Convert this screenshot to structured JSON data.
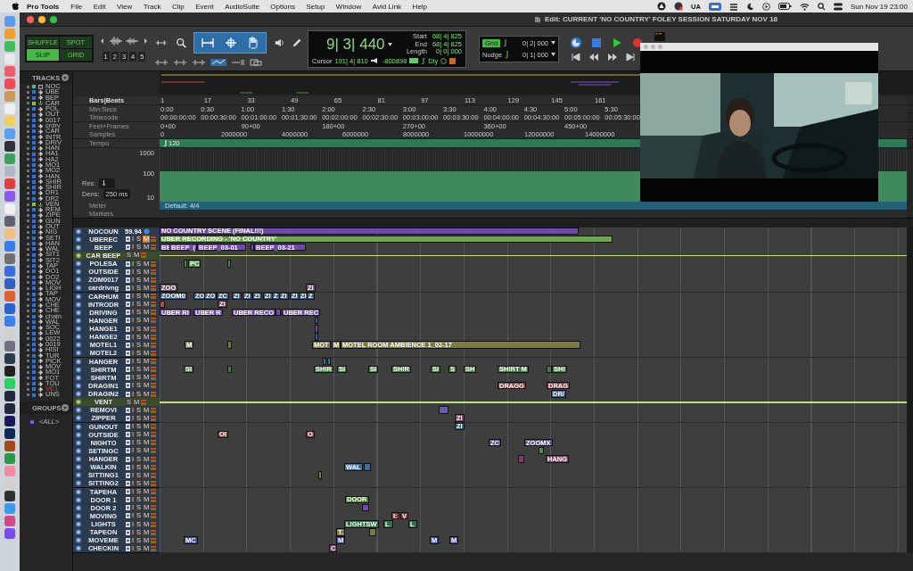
{
  "menu_bar": {
    "app": "Pro Tools",
    "menus": [
      "File",
      "Edit",
      "View",
      "Track",
      "Clip",
      "Event",
      "AudioSuite",
      "Options",
      "Setup",
      "Window",
      "Avid Link",
      "Help"
    ],
    "status_text": "UA",
    "clock": "Sun Nov 19  23:00"
  },
  "window": {
    "title": "Edit: CURRENT 'NO COUNTRY' FOLEY SESSION SATURDAY NOV 18"
  },
  "toolbar": {
    "modes": [
      {
        "label": "SHUFFLE",
        "selected": false
      },
      {
        "label": "SPOT",
        "selected": false
      },
      {
        "label": "SLIP",
        "selected": true
      },
      {
        "label": "GRID",
        "selected": false
      }
    ],
    "zoom_presets": [
      "1",
      "2",
      "3",
      "4",
      "5"
    ],
    "counter": {
      "main": "9| 3| 440",
      "start_label": "Start",
      "start": "68| 4| 825",
      "end_label": "End",
      "end": "68| 4| 825",
      "length_label": "Length",
      "length": "0| 0| 000",
      "cursor_label": "Cursor",
      "cursor": "191| 4| 810",
      "sample": "-800898",
      "delay": "Dly"
    },
    "grid": {
      "label": "Grid",
      "value": "0| 2| 000"
    },
    "nudge": {
      "label": "Nudge",
      "value": "0| 1| 000"
    }
  },
  "tracks_panel": {
    "title": "TRACKS",
    "tracks": [
      {
        "name": "NOC",
        "kind": "video",
        "color": "#3fb39b",
        "selected": false
      },
      {
        "name": "UBE",
        "kind": "audio",
        "color": "#2f6fe0",
        "selected": false
      },
      {
        "name": "BEP",
        "kind": "audio",
        "color": "#2f6fe0",
        "selected": false
      },
      {
        "name": "CAR",
        "kind": "folder",
        "color": "#8fbf3a",
        "selected": false
      },
      {
        "name": "POL",
        "kind": "audio",
        "color": "#2f6fe0",
        "selected": false
      },
      {
        "name": "OUT",
        "kind": "audio",
        "color": "#2f6fe0",
        "selected": false
      },
      {
        "name": "0017",
        "kind": "audio",
        "color": "#2f6fe0",
        "selected": false
      },
      {
        "name": "crdrv",
        "kind": "audio",
        "color": "#2f6fe0",
        "selected": false
      },
      {
        "name": "CAR",
        "kind": "audio",
        "color": "#2f6fe0",
        "selected": false
      },
      {
        "name": "INTR",
        "kind": "audio",
        "color": "#2f6fe0",
        "selected": false
      },
      {
        "name": "DRIV",
        "kind": "audio",
        "color": "#2f6fe0",
        "selected": false
      },
      {
        "name": "HAN",
        "kind": "audio",
        "color": "#2f6fe0",
        "selected": false
      },
      {
        "name": "HA1",
        "kind": "audio",
        "color": "#2f6fe0",
        "selected": false
      },
      {
        "name": "HA2",
        "kind": "audio",
        "color": "#2f6fe0",
        "selected": false
      },
      {
        "name": "MO1",
        "kind": "audio",
        "color": "#2f6fe0",
        "selected": false
      },
      {
        "name": "MO2",
        "kind": "audio",
        "color": "#2f6fe0",
        "selected": false
      },
      {
        "name": "HAN",
        "kind": "audio",
        "color": "#2f6fe0",
        "selected": false
      },
      {
        "name": "SHIR",
        "kind": "audio",
        "color": "#2f6fe0",
        "selected": false
      },
      {
        "name": "SHIR",
        "kind": "audio",
        "color": "#2f6fe0",
        "selected": false
      },
      {
        "name": "DR1",
        "kind": "audio",
        "color": "#2f6fe0",
        "selected": false
      },
      {
        "name": "DR2",
        "kind": "audio",
        "color": "#2f6fe0",
        "selected": false
      },
      {
        "name": "VEN",
        "kind": "folder",
        "color": "#8fbf3a",
        "selected": false
      },
      {
        "name": "REM",
        "kind": "audio",
        "color": "#2f6fe0",
        "selected": false
      },
      {
        "name": "ZIPE",
        "kind": "audio",
        "color": "#2f6fe0",
        "selected": false
      },
      {
        "name": "GUN",
        "kind": "audio",
        "color": "#2f6fe0",
        "selected": false
      },
      {
        "name": "OUT",
        "kind": "audio",
        "color": "#2f6fe0",
        "selected": false
      },
      {
        "name": "NIG",
        "kind": "audio",
        "color": "#2f6fe0",
        "selected": false
      },
      {
        "name": "SETI",
        "kind": "audio",
        "color": "#2f6fe0",
        "selected": false
      },
      {
        "name": "HAN",
        "kind": "audio",
        "color": "#2f6fe0",
        "selected": false
      },
      {
        "name": "WAL",
        "kind": "audio",
        "color": "#2f6fe0",
        "selected": false
      },
      {
        "name": "SIT1",
        "kind": "audio",
        "color": "#2f6fe0",
        "selected": false
      },
      {
        "name": "SIT2",
        "kind": "audio",
        "color": "#2f6fe0",
        "selected": false
      },
      {
        "name": "TAP",
        "kind": "audio",
        "color": "#2f6fe0",
        "selected": false
      },
      {
        "name": "DO1",
        "kind": "audio",
        "color": "#2f6fe0",
        "selected": false
      },
      {
        "name": "DO2",
        "kind": "audio",
        "color": "#2f6fe0",
        "selected": false
      },
      {
        "name": "MOV",
        "kind": "audio",
        "color": "#2f6fe0",
        "selected": false
      },
      {
        "name": "LIGH",
        "kind": "audio",
        "color": "#2f6fe0",
        "selected": false
      },
      {
        "name": "TAP",
        "kind": "audio",
        "color": "#2f6fe0",
        "selected": false
      },
      {
        "name": "MOV",
        "kind": "audio",
        "color": "#2f6fe0",
        "selected": false
      },
      {
        "name": "CHE",
        "kind": "audio",
        "color": "#2f6fe0",
        "selected": false
      },
      {
        "name": "CHE",
        "kind": "audio",
        "color": "#2f6fe0",
        "selected": false
      },
      {
        "name": "chain",
        "kind": "audio",
        "color": "#2f6fe0",
        "selected": false
      },
      {
        "name": "WAL",
        "kind": "audio",
        "color": "#2f6fe0",
        "selected": false
      },
      {
        "name": "SOC",
        "kind": "audio",
        "color": "#2f6fe0",
        "selected": false
      },
      {
        "name": "LEW",
        "kind": "audio",
        "color": "#2f6fe0",
        "selected": false
      },
      {
        "name": "0022",
        "kind": "audio",
        "color": "#2f6fe0",
        "selected": false
      },
      {
        "name": "0019",
        "kind": "audio",
        "color": "#2f6fe0",
        "selected": false
      },
      {
        "name": "HISI",
        "kind": "audio",
        "color": "#2f6fe0",
        "selected": false
      },
      {
        "name": "TUR",
        "kind": "audio",
        "color": "#2f6fe0",
        "selected": false
      },
      {
        "name": "PICK",
        "kind": "audio",
        "color": "#2f6fe0",
        "selected": false
      },
      {
        "name": "MOV",
        "kind": "audio",
        "color": "#2f6fe0",
        "selected": false
      },
      {
        "name": "MO1",
        "kind": "audio",
        "color": "#2f6fe0",
        "selected": false
      },
      {
        "name": "FOT",
        "kind": "audio",
        "color": "#2f6fe0",
        "selected": false
      },
      {
        "name": "TOU",
        "kind": "audio",
        "color": "#2f6fe0",
        "selected": false
      },
      {
        "name": "VE1",
        "kind": "audio",
        "color": "#2f6fe0",
        "selected": true
      },
      {
        "name": "UNS",
        "kind": "audio",
        "color": "#2f6fe0",
        "selected": false
      }
    ]
  },
  "groups_panel": {
    "title": "GROUPS",
    "groups": [
      {
        "name": "<ALL>",
        "color": "#6a5cff"
      }
    ]
  },
  "rulers": [
    {
      "label": "Bars|Beats",
      "ticks": [
        "1",
        "17",
        "33",
        "49",
        "65",
        "81",
        "97",
        "113",
        "129",
        "145",
        "161"
      ]
    },
    {
      "label": "Min:Secs",
      "ticks": [
        "0:00",
        "0:30",
        "1:00",
        "1:30",
        "2:00",
        "2:30",
        "3:00",
        "3:30",
        "4:00",
        "4:30",
        "5:00",
        "5:30"
      ]
    },
    {
      "label": "Timecode",
      "ticks": [
        "00:00:00:00",
        "00:00:30:00",
        "00:01:00:00",
        "00:01:30:00",
        "00:02:00:00",
        "00:02:30:00",
        "00:03:00:00",
        "00:03:30:00",
        "00:04:00:00",
        "00:04:30:00",
        "00:05:00:00",
        "00:05:30:00"
      ]
    },
    {
      "label": "Feet+Frames",
      "ticks": [
        "0+00",
        "90+00",
        "180+00",
        "270+00",
        "360+00",
        "450+00"
      ]
    },
    {
      "label": "Samples",
      "ticks": [
        "0",
        "2000000",
        "4000000",
        "6000000",
        "8000000",
        "10000000",
        "12000000",
        "14000000"
      ]
    }
  ],
  "tempo": {
    "label": "Tempo",
    "value": "120",
    "scale": [
      "1000",
      "100",
      "10"
    ],
    "res_label": "Res:",
    "dens_label": "Dens:",
    "dens": "250 ms"
  },
  "meter": {
    "label": "Meter",
    "value": "Default: 4/4"
  },
  "markers": {
    "label": "Markers"
  },
  "edit_tracks": [
    {
      "name": "NOCOUN",
      "kind": "video",
      "rate": "59.94",
      "clips": [
        {
          "label": "NO COUNTRY SCENE (FINAL!!!)",
          "color": "#7048b0"
        }
      ]
    },
    {
      "name": "UBEREC",
      "kind": "audio",
      "buttons": [
        "I",
        "S",
        "M"
      ],
      "muted": true,
      "clips": [
        {
          "label": "UBER RECORDING - 'NO COUNTRY'",
          "color": "#6fa84a"
        }
      ]
    },
    {
      "name": "BEEP",
      "kind": "audio",
      "buttons": [
        "I",
        "S",
        "M"
      ],
      "muted": false,
      "clips": [
        {
          "label": "BE",
          "color": "#7048b0"
        },
        {
          "label": "BEEP_(",
          "color": "#7048b0"
        },
        {
          "label": "BEEP_03-01",
          "color": "#7048b0"
        },
        {
          "color": "#7048b0"
        },
        {
          "label": "BEEP_03-21",
          "color": "#7048b0"
        }
      ]
    },
    {
      "name": "CAR BEEP",
      "kind": "folder",
      "buttons": [
        "S",
        "M"
      ],
      "muted": false
    },
    {
      "name": "POLESA",
      "kind": "audio",
      "buttons": [
        "I",
        "S",
        "M"
      ],
      "muted": false,
      "clips": [
        {
          "color": "#4f8a4a"
        },
        {
          "label": "PC",
          "color": "#4f8a4a"
        },
        {
          "color": "#4f8a4a"
        }
      ]
    },
    {
      "name": "OUTSIDE",
      "kind": "audio",
      "buttons": [
        "I",
        "S",
        "M"
      ],
      "muted": false
    },
    {
      "name": "ZOM0017",
      "kind": "audio",
      "buttons": [
        "I",
        "S",
        "M"
      ],
      "muted": false
    },
    {
      "name": "cardrivng",
      "kind": "audio",
      "buttons": [
        "I",
        "S",
        "M"
      ],
      "muted": false,
      "clips": [
        {
          "label": "ZOO",
          "color": "#7a4a6a"
        },
        {
          "label": "ZI",
          "color": "#7a4a6a"
        }
      ]
    },
    {
      "name": "CARHUM",
      "kind": "audio",
      "buttons": [
        "I",
        "S",
        "M"
      ],
      "muted": false,
      "clips": [
        {
          "label": "ZOOM0",
          "color": "#3d5d80"
        },
        {
          "label": "ZO",
          "color": "#3d5d80"
        },
        {
          "label": "ZO",
          "color": "#3d5d80"
        },
        {
          "label": "ZC",
          "color": "#3d5d80"
        },
        {
          "label": "ZI",
          "color": "#3d5d80"
        },
        {
          "label": "ZI",
          "color": "#3d5d80"
        },
        {
          "label": "ZI",
          "color": "#3d5d80"
        },
        {
          "label": "ZI",
          "color": "#3d5d80"
        },
        {
          "label": "Z",
          "color": "#3d5d80"
        },
        {
          "label": "ZI",
          "color": "#3d5d80"
        },
        {
          "label": "ZI",
          "color": "#3d5d80"
        },
        {
          "label": "ZI",
          "color": "#3d5d80"
        },
        {
          "label": "Z",
          "color": "#3d5d80"
        }
      ]
    },
    {
      "name": "INTRODR",
      "kind": "audio",
      "buttons": [
        "I",
        "S",
        "M"
      ],
      "muted": false,
      "clips": [
        {
          "color": "#b04a4a"
        },
        {
          "label": "ZI",
          "color": "#8a3a5a"
        }
      ]
    },
    {
      "name": "DRIVING",
      "kind": "audio",
      "buttons": [
        "I",
        "S",
        "M"
      ],
      "muted": false,
      "clips": [
        {
          "label": "UBER RI",
          "color": "#7048b0"
        },
        {
          "label": "UBER R",
          "color": "#7048b0"
        },
        {
          "label": "UBER RECO",
          "color": "#7048b0"
        },
        {
          "color": "#7048b0"
        },
        {
          "label": "UBER REC",
          "color": "#7048b0"
        }
      ]
    },
    {
      "name": "HANGER",
      "kind": "audio",
      "buttons": [
        "I",
        "S",
        "M"
      ],
      "muted": false,
      "clips": [
        {
          "color": "#3d5d80"
        }
      ]
    },
    {
      "name": "HANGE1",
      "kind": "audio",
      "buttons": [
        "I",
        "S",
        "M"
      ],
      "muted": false,
      "clips": [
        {
          "color": "#7048b0"
        }
      ]
    },
    {
      "name": "HANGE2",
      "kind": "audio",
      "buttons": [
        "I",
        "S",
        "M"
      ],
      "muted": false,
      "clips": [
        {
          "color": "#3d5d80"
        }
      ]
    },
    {
      "name": "MOTEL1",
      "kind": "audio",
      "buttons": [
        "I",
        "S",
        "M"
      ],
      "muted": false,
      "clips": [
        {
          "label": "M",
          "color": "#7d7a3a"
        },
        {
          "color": "#7d7a3a"
        },
        {
          "label": "MOT",
          "color": "#7d7a3a"
        },
        {
          "label": "M",
          "color": "#7d7a3a"
        },
        {
          "label": "MOTEL ROOM AMBIENCE 1_02-17",
          "color": "#7d7a3a"
        }
      ]
    },
    {
      "name": "MOTEL2",
      "kind": "audio",
      "buttons": [
        "I",
        "S",
        "M"
      ],
      "muted": false
    },
    {
      "name": "HANGER",
      "kind": "audio",
      "buttons": [
        "I",
        "S",
        "M"
      ],
      "muted": false,
      "clips": [
        {
          "color": "#3d6d9a"
        },
        {
          "color": "#3d6d9a"
        }
      ]
    },
    {
      "name": "SHIRTM",
      "kind": "audio",
      "buttons": [
        "I",
        "S",
        "M"
      ],
      "muted": false,
      "clips": [
        {
          "label": "SI",
          "color": "#4f7a4a"
        },
        {
          "color": "#4f7a4a"
        },
        {
          "label": "SHIR",
          "color": "#4f7a4a"
        },
        {
          "label": "SI",
          "color": "#4f7a4a"
        },
        {
          "label": "SI",
          "color": "#4f7a4a"
        },
        {
          "label": "SHIR",
          "color": "#4f7a4a"
        },
        {
          "label": "SI",
          "color": "#4f7a4a"
        },
        {
          "label": "S",
          "color": "#4f7a4a"
        },
        {
          "label": "SH",
          "color": "#4f7a4a"
        },
        {
          "label": "SHIRT M",
          "color": "#4f7a4a"
        },
        {
          "color": "#4f7a4a"
        },
        {
          "label": "SHI",
          "color": "#4f7a4a"
        }
      ]
    },
    {
      "name": "SHIRTM",
      "kind": "audio",
      "buttons": [
        "I",
        "S",
        "M"
      ],
      "muted": false
    },
    {
      "name": "DRAGIN1",
      "kind": "audio",
      "buttons": [
        "I",
        "S",
        "M"
      ],
      "muted": false,
      "clips": [
        {
          "label": "DRAGG",
          "color": "#8a3a3a"
        },
        {
          "label": "DRAG",
          "color": "#8a3a3a"
        }
      ]
    },
    {
      "name": "DRAGIN2",
      "kind": "audio",
      "buttons": [
        "I",
        "S",
        "M"
      ],
      "muted": false,
      "clips": [
        {
          "label": "DR/",
          "color": "#3d5d80"
        }
      ]
    },
    {
      "name": "VENT",
      "kind": "folder",
      "buttons": [
        "S",
        "M"
      ],
      "muted": false
    },
    {
      "name": "REMOVI",
      "kind": "audio",
      "buttons": [
        "I",
        "S",
        "M"
      ],
      "muted": false,
      "clips": [
        {
          "color": "#6a5cb0"
        }
      ]
    },
    {
      "name": "ZIPPER",
      "kind": "audio",
      "buttons": [
        "I",
        "S",
        "M"
      ],
      "muted": false,
      "clips": [
        {
          "label": "ZI",
          "color": "#8a3a6a"
        }
      ]
    },
    {
      "name": "GUNOUT",
      "kind": "audio",
      "buttons": [
        "I",
        "S",
        "M"
      ],
      "muted": false,
      "clips": [
        {
          "label": "ZI",
          "color": "#3d5d80"
        }
      ]
    },
    {
      "name": "OUTSIDE",
      "kind": "audio",
      "buttons": [
        "I",
        "S",
        "M"
      ],
      "muted": false,
      "clips": [
        {
          "label": "OI",
          "color": "#8a3a3a"
        },
        {
          "label": "O",
          "color": "#8a3a3a"
        }
      ]
    },
    {
      "name": "NIGHTO",
      "kind": "audio",
      "buttons": [
        "I",
        "S",
        "M"
      ],
      "muted": false,
      "clips": [
        {
          "label": "ZC",
          "color": "#5a4a8a"
        },
        {
          "label": "ZOOMX",
          "color": "#5a4a8a"
        }
      ]
    },
    {
      "name": "SETINGC",
      "kind": "audio",
      "buttons": [
        "I",
        "S",
        "M"
      ],
      "muted": false,
      "clips": [
        {
          "color": "#4f8a4a"
        }
      ]
    },
    {
      "name": "HANGER",
      "kind": "audio",
      "buttons": [
        "I",
        "S",
        "M"
      ],
      "muted": false,
      "clips": [
        {
          "color": "#8a3a6a"
        },
        {
          "label": "HANG",
          "color": "#8a3a6a"
        }
      ]
    },
    {
      "name": "WALKIN",
      "kind": "audio",
      "buttons": [
        "I",
        "S",
        "M"
      ],
      "muted": false,
      "clips": [
        {
          "label": "WAL",
          "color": "#3d6d9a"
        },
        {
          "color": "#3d6d9a"
        }
      ]
    },
    {
      "name": "SITTING1",
      "kind": "audio",
      "buttons": [
        "I",
        "S",
        "M"
      ],
      "muted": false,
      "clips": [
        {
          "color": "#7d7a3a"
        }
      ]
    },
    {
      "name": "SITTING2",
      "kind": "audio",
      "buttons": [
        "I",
        "S",
        "M"
      ],
      "muted": false
    },
    {
      "name": "TAPEHA",
      "kind": "audio",
      "buttons": [
        "I",
        "S",
        "M"
      ],
      "muted": false
    },
    {
      "name": "DOOR 1",
      "kind": "audio",
      "buttons": [
        "I",
        "S",
        "M"
      ],
      "muted": false,
      "clips": [
        {
          "label": "DOOR",
          "color": "#4f7a3a"
        }
      ]
    },
    {
      "name": "DOOR 2",
      "kind": "audio",
      "buttons": [
        "I",
        "S",
        "M"
      ],
      "muted": false,
      "clips": [
        {
          "color": "#7048b0"
        }
      ]
    },
    {
      "name": "MOVING",
      "kind": "audio",
      "buttons": [
        "I",
        "S",
        "M"
      ],
      "muted": false,
      "clips": [
        {
          "label": "I:",
          "color": "#8a3a3a"
        },
        {
          "label": "V",
          "color": "#8a3a3a"
        }
      ]
    },
    {
      "name": "LIGHTS",
      "kind": "audio",
      "buttons": [
        "I",
        "S",
        "M"
      ],
      "muted": false,
      "clips": [
        {
          "label": "LIGHTSW",
          "color": "#3a6a4a"
        },
        {
          "label": "L",
          "color": "#3a6a4a"
        },
        {
          "label": "L",
          "color": "#3a6a4a"
        }
      ]
    },
    {
      "name": "TAPEON",
      "kind": "audio",
      "buttons": [
        "I",
        "S",
        "M"
      ],
      "muted": false,
      "clips": [
        {
          "label": "T.",
          "color": "#7d7a3a"
        },
        {
          "color": "#7d7a3a"
        }
      ]
    },
    {
      "name": "MOVEME",
      "kind": "audio",
      "buttons": [
        "I",
        "S",
        "M"
      ],
      "muted": false,
      "clips": [
        {
          "label": "MC",
          "color": "#4a4a8a"
        },
        {
          "label": "M",
          "color": "#4a4a8a"
        },
        {
          "label": "M",
          "color": "#4a4a8a"
        },
        {
          "label": "M",
          "color": "#4a4a8a"
        }
      ]
    },
    {
      "name": "CHECKIN",
      "kind": "audio",
      "buttons": [
        "I",
        "S",
        "M"
      ],
      "muted": false,
      "clips": [
        {
          "label": "C",
          "color": "#7a3a6a"
        }
      ]
    }
  ]
}
